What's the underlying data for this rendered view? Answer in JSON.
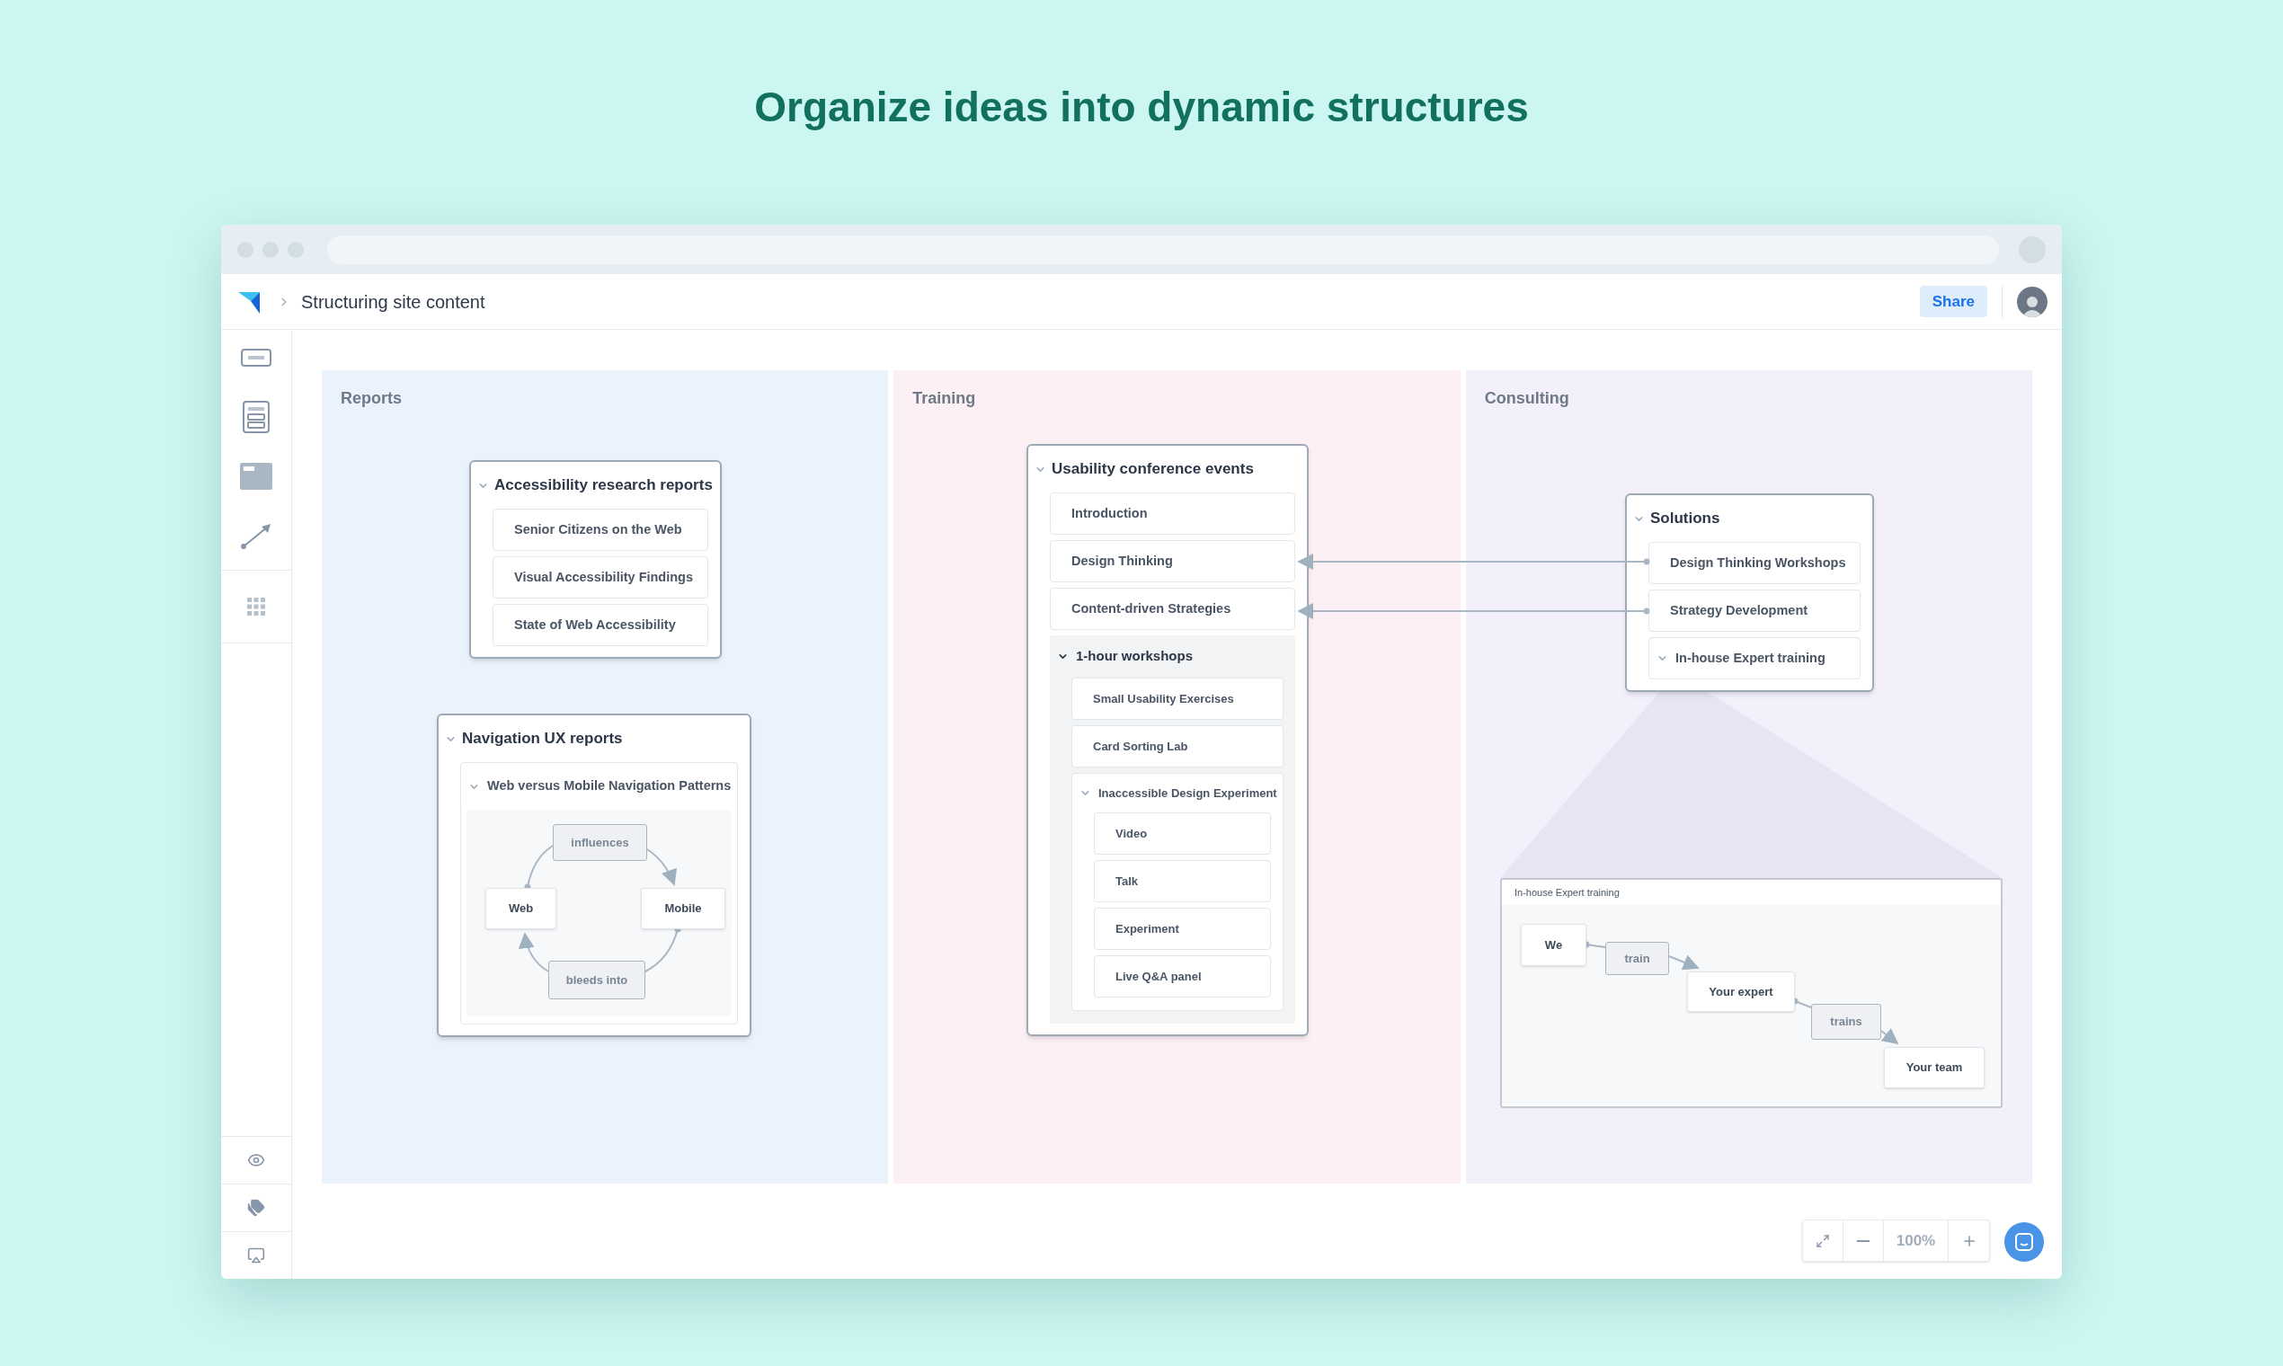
{
  "headline": "Organize ideas into dynamic structures",
  "header": {
    "title": "Structuring site content",
    "share": "Share"
  },
  "columns": [
    {
      "title": "Reports",
      "cards": [
        {
          "label": "Accessibility research reports",
          "expanded": true,
          "children": [
            {
              "label": "Senior Citizens on the Web"
            },
            {
              "label": "Visual Accessibility Findings"
            },
            {
              "label": "State of Web Accessibility"
            }
          ]
        },
        {
          "label": "Navigation UX reports",
          "expanded": true,
          "children": [
            {
              "label": "Web versus Mobile Navigation Patterns",
              "expanded": true,
              "diagram": [
                {
                  "label": "influences",
                  "kind": "relation"
                },
                {
                  "label": "Web",
                  "kind": "entity"
                },
                {
                  "label": "Mobile",
                  "kind": "entity"
                },
                {
                  "label": "bleeds into",
                  "kind": "relation"
                }
              ]
            }
          ]
        }
      ]
    },
    {
      "title": "Training",
      "cards": [
        {
          "label": "Usability conference events",
          "expanded": true,
          "children": [
            {
              "label": "Introduction"
            },
            {
              "label": "Design Thinking"
            },
            {
              "label": "Content-driven Strategies"
            },
            {
              "label": "1-hour workshops",
              "expanded": true,
              "children": [
                {
                  "label": "Small Usability Exercises"
                },
                {
                  "label": "Card Sorting Lab"
                },
                {
                  "label": "Inaccessible Design Experiment",
                  "expanded": true,
                  "children": [
                    {
                      "label": "Video"
                    },
                    {
                      "label": "Talk"
                    },
                    {
                      "label": "Experiment"
                    },
                    {
                      "label": "Live Q&A panel"
                    }
                  ]
                }
              ]
            }
          ]
        }
      ]
    },
    {
      "title": "Consulting",
      "cards": [
        {
          "label": "Solutions",
          "expanded": true,
          "children": [
            {
              "label": "Design Thinking Workshops"
            },
            {
              "label": "Strategy Development"
            },
            {
              "label": "In-house Expert training",
              "expanded": true,
              "detail": {
                "title": "In-house Expert training",
                "nodes": [
                  {
                    "label": "We",
                    "kind": "entity"
                  },
                  {
                    "label": "train",
                    "kind": "relation"
                  },
                  {
                    "label": "Your expert",
                    "kind": "entity"
                  },
                  {
                    "label": "trains",
                    "kind": "relation"
                  },
                  {
                    "label": "Your team",
                    "kind": "entity"
                  }
                ]
              }
            }
          ]
        }
      ]
    }
  ],
  "zoom": {
    "level_text": "100%"
  }
}
